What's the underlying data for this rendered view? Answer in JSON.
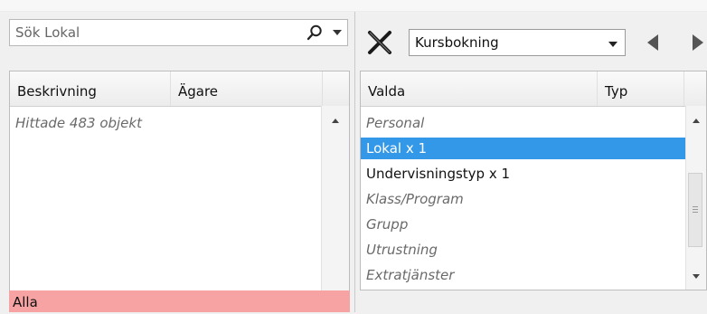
{
  "search": {
    "value": "Sök Lokal"
  },
  "left_list": {
    "columns": [
      "Beskrivning",
      "Ägare"
    ],
    "status_text": "Hittade 483 objekt",
    "footer_label": "Alla"
  },
  "toolbar": {
    "combo_value": "Kursbokning"
  },
  "right_list": {
    "columns": [
      "Valda",
      "Typ"
    ],
    "rows": [
      {
        "label": "Personal",
        "style": "italic"
      },
      {
        "label": "Lokal x 1",
        "style": "selected"
      },
      {
        "label": "Undervisningstyp x 1",
        "style": "normal"
      },
      {
        "label": "Klass/Program",
        "style": "italic"
      },
      {
        "label": "Grupp",
        "style": "italic"
      },
      {
        "label": "Utrustning",
        "style": "italic"
      },
      {
        "label": "Extratjänster",
        "style": "italic"
      }
    ]
  },
  "colors": {
    "selection": "#3398e8",
    "footer_bg": "#f7a3a3"
  }
}
